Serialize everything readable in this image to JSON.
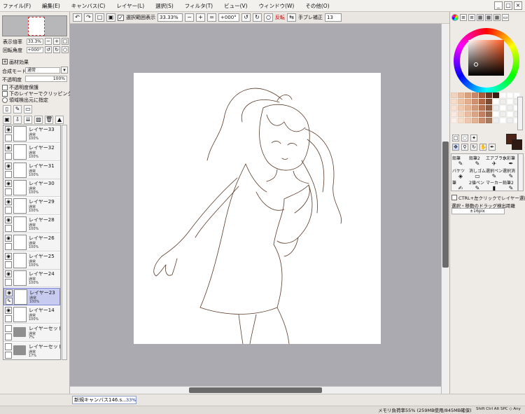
{
  "menu": [
    "ファイル(F)",
    "編集(E)",
    "キャンバス(C)",
    "レイヤー(L)",
    "選択(S)",
    "フィルタ(T)",
    "ビュー(V)",
    "ウィンドウ(W)",
    "その他(O)"
  ],
  "toolbar": {
    "selection_display_label": "選択範囲表示",
    "zoom": "33.33%",
    "angle": "+000°",
    "flip_label": "反転",
    "stabilizer_label": "手ブレ補正",
    "stabilizer_value": "13"
  },
  "navigator": {
    "zoom_label": "表示倍率",
    "zoom_value": "33.3%",
    "angle_label": "回転角度",
    "angle_value": "+000°"
  },
  "layer_panel": {
    "effects_label": "画材効果",
    "blend_label": "合成モード",
    "blend_value": "通常",
    "opacity_label": "不透明度",
    "opacity_value": "100%",
    "protect_label": "不透明度保護",
    "clip_label": "下のレイヤーでクリッピング",
    "select_source_label": "領域検出元に指定"
  },
  "layers": [
    {
      "name": "レイヤー33",
      "mode": "通常",
      "opacity": "100%",
      "type": "layer",
      "visible": true
    },
    {
      "name": "レイヤー32",
      "mode": "通常",
      "opacity": "100%",
      "type": "layer",
      "visible": true
    },
    {
      "name": "レイヤー31",
      "mode": "通常",
      "opacity": "100%",
      "type": "layer",
      "visible": true
    },
    {
      "name": "レイヤー30",
      "mode": "通常",
      "opacity": "100%",
      "type": "layer",
      "visible": true
    },
    {
      "name": "レイヤー29",
      "mode": "通常",
      "opacity": "100%",
      "type": "layer",
      "visible": true
    },
    {
      "name": "レイヤー28",
      "mode": "通常",
      "opacity": "100%",
      "type": "layer",
      "visible": true
    },
    {
      "name": "レイヤー26",
      "mode": "通常",
      "opacity": "100%",
      "type": "layer",
      "visible": true
    },
    {
      "name": "レイヤー25",
      "mode": "通常",
      "opacity": "100%",
      "type": "layer",
      "visible": true
    },
    {
      "name": "レイヤー24",
      "mode": "通常",
      "opacity": "100%",
      "type": "layer",
      "visible": true
    },
    {
      "name": "レイヤー23",
      "mode": "通常",
      "opacity": "100%",
      "type": "layer",
      "visible": true,
      "selected": true
    },
    {
      "name": "レイヤー14",
      "mode": "通常",
      "opacity": "100%",
      "type": "layer",
      "visible": true
    },
    {
      "name": "レイヤーセット2",
      "mode": "通常",
      "opacity": "7%",
      "type": "folder",
      "visible": false
    },
    {
      "name": "レイヤーセット1",
      "mode": "通常",
      "opacity": "17%",
      "type": "folder",
      "visible": false
    }
  ],
  "tools": [
    "鉛筆",
    "鉛筆2",
    "エアブラシ",
    "水彩筆",
    "バケツ",
    "消しゴム",
    "選択ペン",
    "選択消",
    "筆",
    "2値ペン",
    "マーカー",
    "鉛筆2"
  ],
  "right_panel": {
    "ctrl_select_label": "CTRL+左クリックでレイヤー選択",
    "drag_threshold_label": "選択・移動のドラッグ検出距離",
    "drag_threshold_value": "±16pix"
  },
  "swatch_colors": [
    "#f2d3bd",
    "#e9b99c",
    "#dba17c",
    "#c9876a",
    "#a65c3d",
    "#6e3a24",
    "#3a1e14",
    "#ffffff",
    "#ffffff",
    "#ffffff",
    "#f6dccb",
    "#efc4a6",
    "#e4ad8b",
    "#cf916f",
    "#b06845",
    "#7d4a32",
    "#ffffff",
    "#eeeeee",
    "#ffffff",
    "#eeeeee",
    "#f7e2d4",
    "#f0cab0",
    "#e6b393",
    "#d39a79",
    "#b97452",
    "#8b5a40",
    "#eeeeee",
    "#ffffff",
    "#eeeeee",
    "#ffffff",
    "#f9e9de",
    "#f3d4bf",
    "#e9bc9f",
    "#da a586",
    "#c08060",
    "#9a6a50",
    "#ffffff",
    "#eeeeee",
    "#ffffff",
    "#eeeeee",
    "#fbf0e8",
    "#f6ddcc",
    "#eec8ae",
    "#e1b294",
    "#c98d6e",
    "#a87a5e",
    "#eeeeee",
    "#ffffff",
    "#eeeeee",
    "#ffffff"
  ],
  "status": {
    "canvas_tab": "新規キャンバス146.s...",
    "canvas_zoom": "33%",
    "memory": "メモリ負荷率55% (259MB使用/845MB確保)",
    "keys": "Shift Ctrl Alt SPC ◇ Any"
  }
}
